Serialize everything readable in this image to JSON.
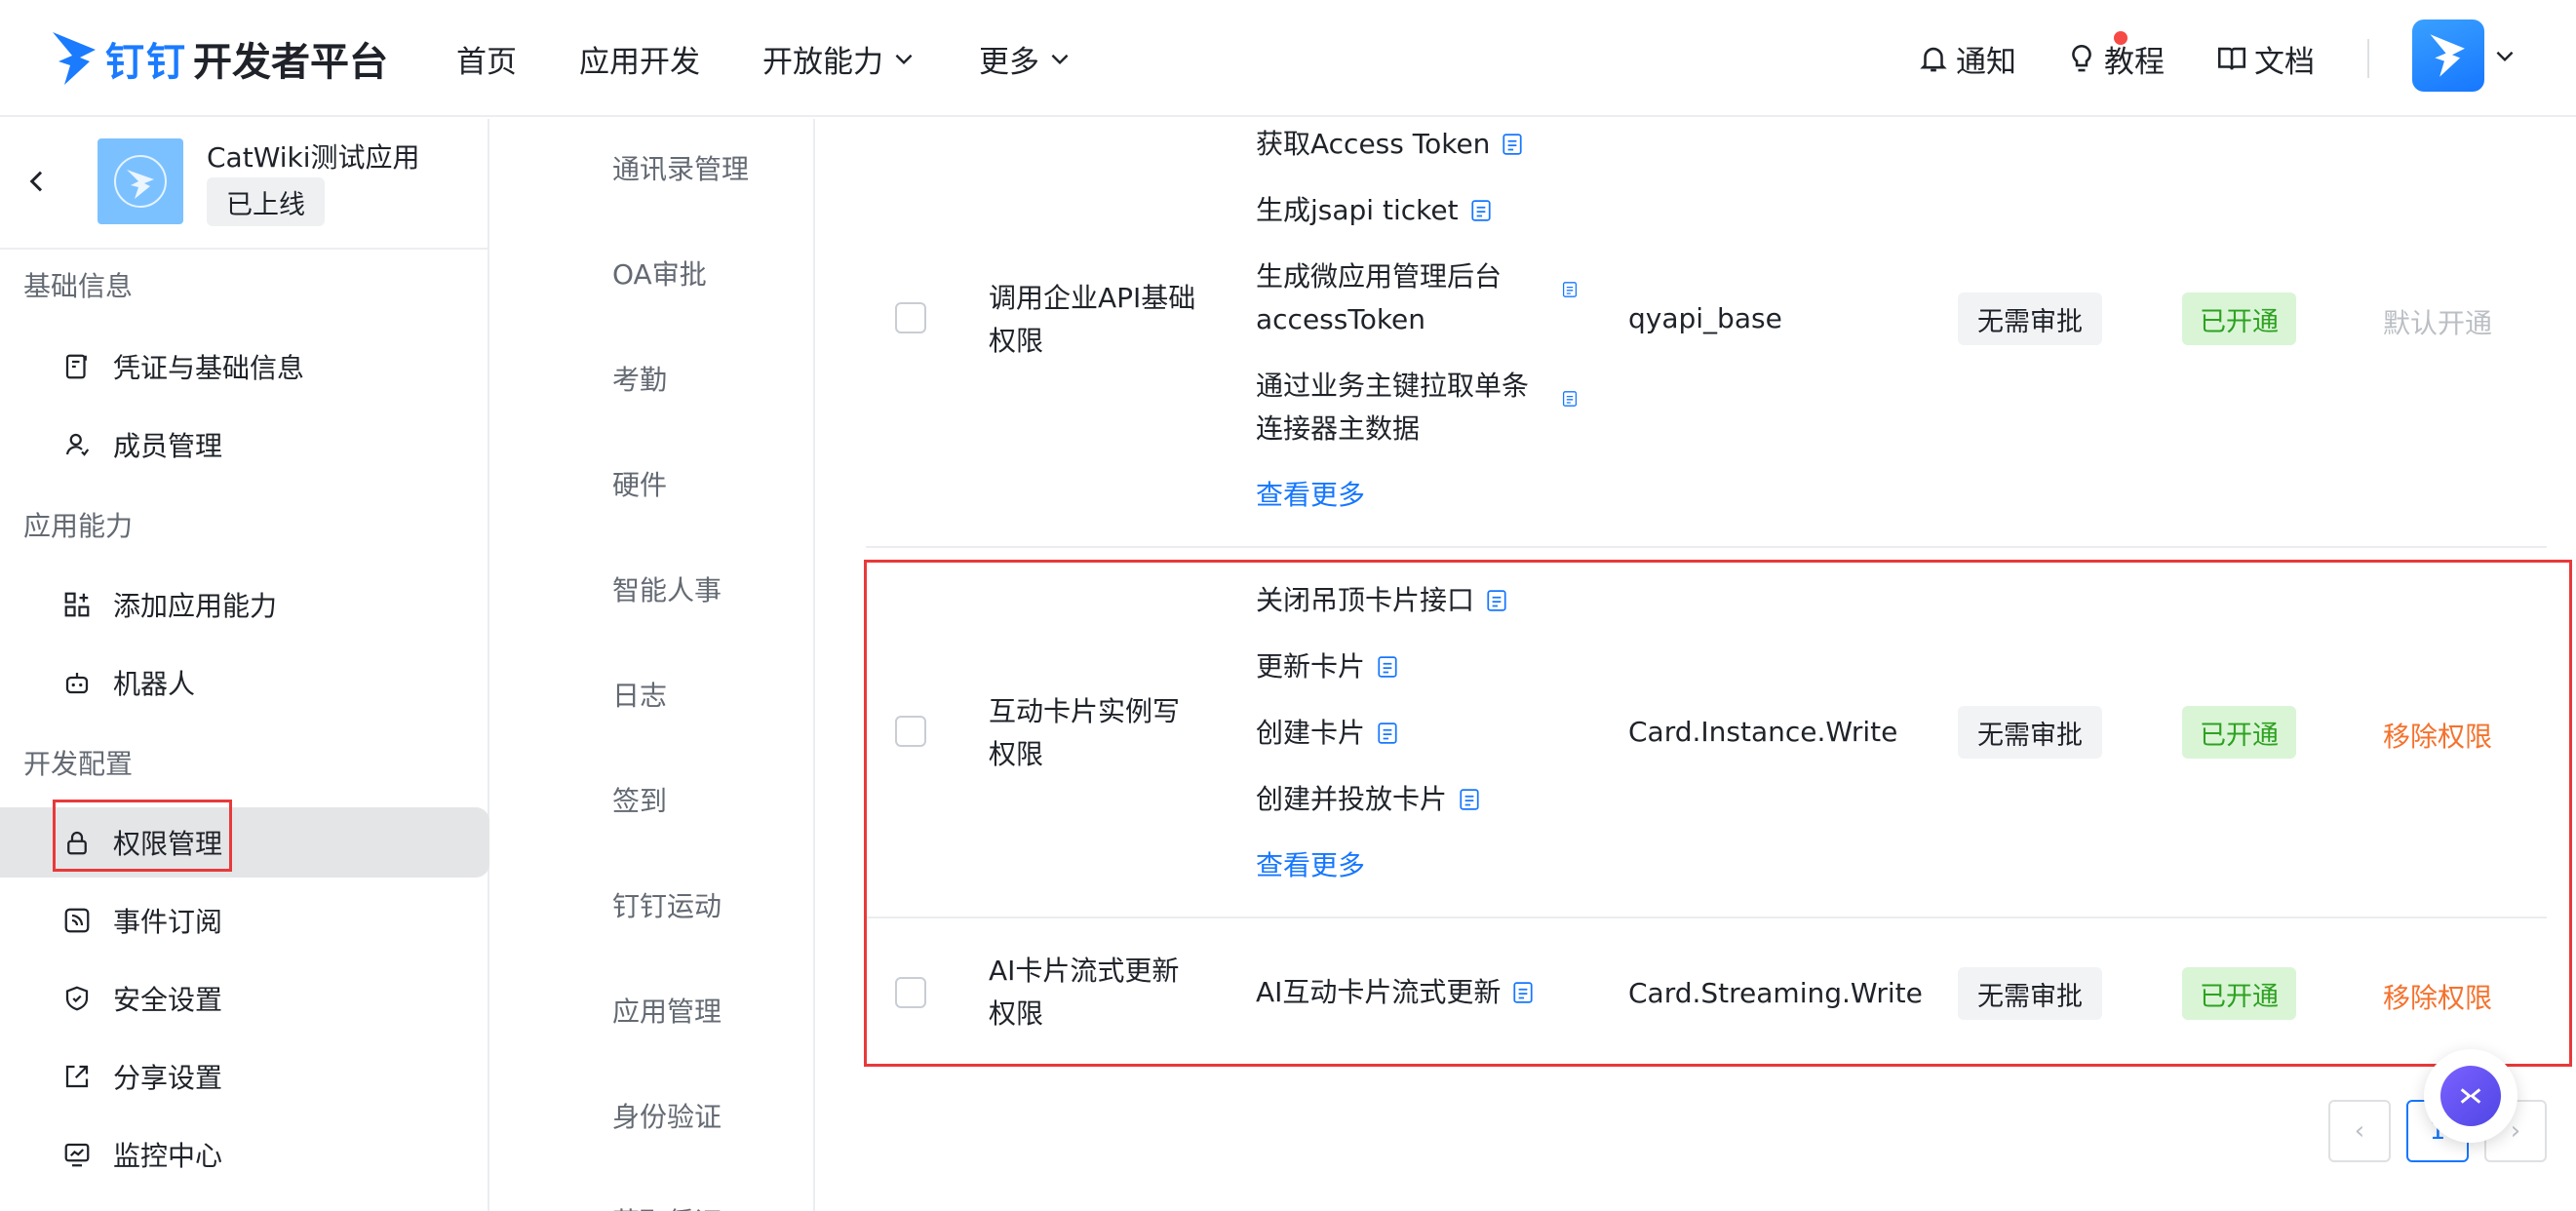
{
  "header": {
    "brand_a": "钉钉",
    "brand_b": "开发者平台",
    "nav": [
      {
        "label": "首页"
      },
      {
        "label": "应用开发"
      },
      {
        "label": "开放能力"
      },
      {
        "label": "更多"
      }
    ],
    "right": {
      "notify": "通知",
      "tutorial": "教程",
      "docs": "文档"
    }
  },
  "sidebar": {
    "app_name": "CatWiki测试应用",
    "app_status": "已上线",
    "groups": [
      {
        "title": "基础信息",
        "items": [
          {
            "label": "凭证与基础信息"
          },
          {
            "label": "成员管理"
          }
        ]
      },
      {
        "title": "应用能力",
        "items": [
          {
            "label": "添加应用能力"
          },
          {
            "label": "机器人"
          }
        ]
      },
      {
        "title": "开发配置",
        "items": [
          {
            "label": "权限管理"
          },
          {
            "label": "事件订阅"
          },
          {
            "label": "安全设置"
          },
          {
            "label": "分享设置"
          },
          {
            "label": "监控中心"
          }
        ]
      }
    ],
    "active_item": "权限管理"
  },
  "categories": [
    "通讯录管理",
    "OA审批",
    "考勤",
    "硬件",
    "智能人事",
    "日志",
    "签到",
    "钉钉运动",
    "应用管理",
    "身份验证",
    "获取凭证"
  ],
  "table": {
    "rows": [
      {
        "name": "调用企业API基础权限",
        "apis": [
          "获取Access Token",
          "生成jsapi ticket",
          "生成微应用管理后台accessToken",
          "通过业务主键拉取单条连接器主数据"
        ],
        "more": "查看更多",
        "code": "qyapi_base",
        "approval": "无需审批",
        "status": "已开通",
        "action": "默认开通"
      },
      {
        "name": "互动卡片实例写权限",
        "apis": [
          "关闭吊顶卡片接口",
          "更新卡片",
          "创建卡片",
          "创建并投放卡片"
        ],
        "more": "查看更多",
        "code": "Card.Instance.Write",
        "approval": "无需审批",
        "status": "已开通",
        "action": "移除权限"
      },
      {
        "name": "AI卡片流式更新权限",
        "apis": [
          "AI互动卡片流式更新"
        ],
        "code": "Card.Streaming.Write",
        "approval": "无需审批",
        "status": "已开通",
        "action": "移除权限"
      }
    ]
  },
  "pagination": {
    "current": "1",
    "prev": "‹",
    "next": "›"
  },
  "colors": {
    "accent": "#1677ff",
    "danger": "#f5722d",
    "success": "#2ea121",
    "highlight": "#e8393a"
  }
}
